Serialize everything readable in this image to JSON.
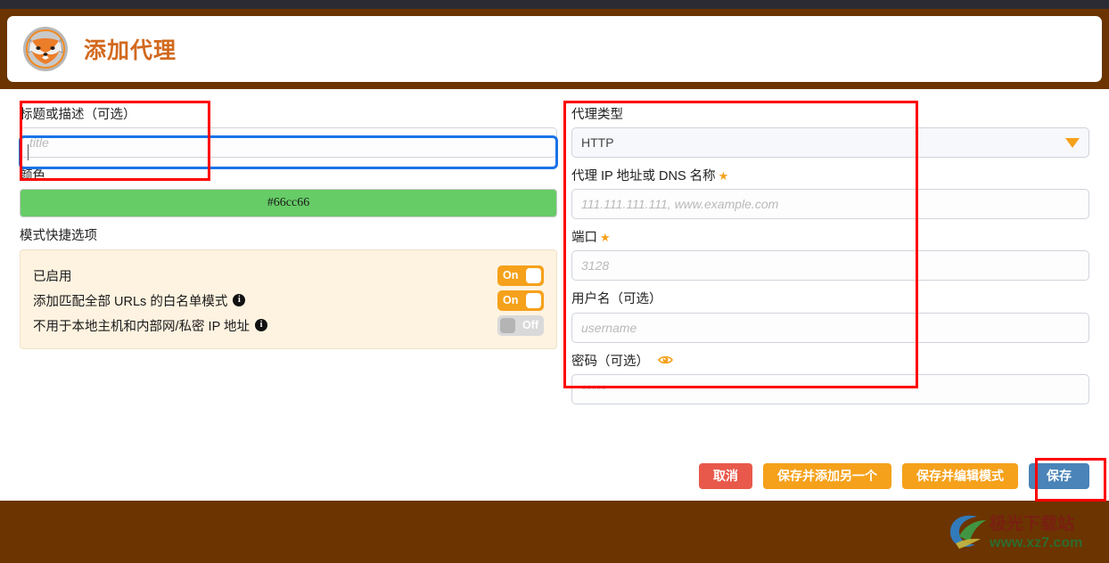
{
  "header": {
    "title": "添加代理",
    "logo_icon": "foxyproxy-fox-icon"
  },
  "left": {
    "title_label": "标题或描述（可选）",
    "title_placeholder": "title",
    "title_value": "",
    "color_label": "颜色",
    "color_value": "#66cc66",
    "color_swatch_hex": "#66cc66",
    "patterns_label": "模式快捷选项",
    "toggles": [
      {
        "label": "已启用",
        "state": "On",
        "on": true,
        "info": false
      },
      {
        "label": "添加匹配全部 URLs 的白名单模式",
        "state": "On",
        "on": true,
        "info": true
      },
      {
        "label": "不用于本地主机和内部网/私密 IP 地址",
        "state": "Off",
        "on": false,
        "info": true
      }
    ],
    "info_icon": "info-icon"
  },
  "right": {
    "type_label": "代理类型",
    "type_value": "HTTP",
    "type_caret_icon": "chevron-down-icon",
    "host_label": "代理 IP 地址或 DNS 名称",
    "host_required_icon": "star-icon",
    "host_placeholder": "111.111.111.111, www.example.com",
    "host_value": "",
    "port_label": "端口",
    "port_required_icon": "star-icon",
    "port_placeholder": "3128",
    "port_value": "",
    "username_label": "用户名（可选）",
    "username_placeholder": "username",
    "username_value": "",
    "password_label": "密码（可选）",
    "password_eye_icon": "eye-icon",
    "password_placeholder": "*****",
    "password_value": ""
  },
  "buttons": {
    "cancel": "取消",
    "save_add_another": "保存并添加另一个",
    "save_edit_patterns": "保存并编辑模式",
    "save": "保存"
  },
  "watermark": {
    "name": "极光下载站",
    "url": "www.xz7.com"
  },
  "colors": {
    "brand_brown": "#6b3400",
    "accent_orange": "#f5a11b",
    "title_orange": "#d2691e",
    "save_blue": "#4a84b8",
    "cancel_red": "#e8594b",
    "annotation_red": "#ff0000",
    "focus_blue": "#1a73e8",
    "panel_beige": "#fdf3e0"
  }
}
